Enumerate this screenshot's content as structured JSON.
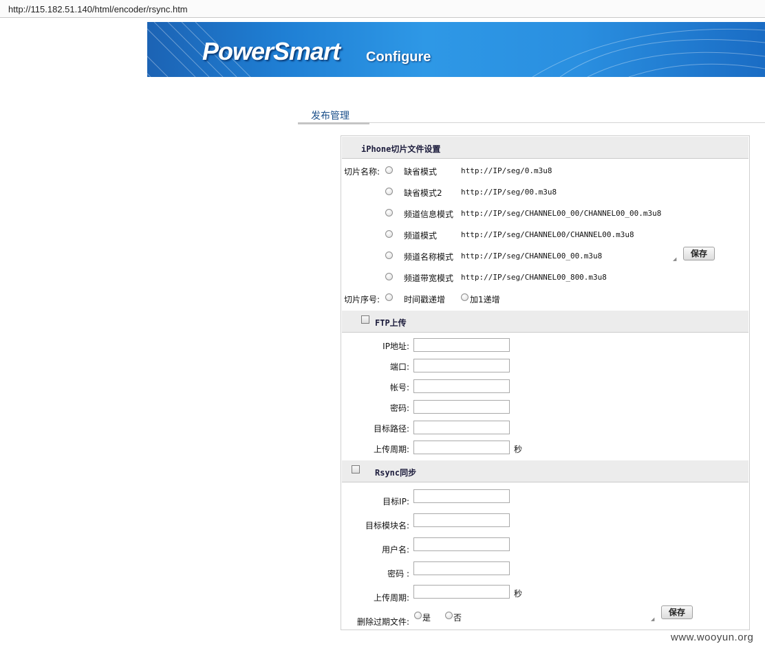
{
  "browser": {
    "url": "http://115.182.51.140/html/encoder/rsync.htm"
  },
  "banner": {
    "brand": "PowerSmart",
    "subtitle": "Configure"
  },
  "nav": {
    "tab_label": "发布管理"
  },
  "iphone_section": {
    "title": "iPhone切片文件设置",
    "name_label": "切片名称:",
    "modes": [
      {
        "name": "缺省模式",
        "url": "http://IP/seg/0.m3u8"
      },
      {
        "name": "缺省模式2",
        "url": "http://IP/seg/00.m3u8"
      },
      {
        "name": "频道信息模式",
        "url": "http://IP/seg/CHANNEL00_00/CHANNEL00_00.m3u8"
      },
      {
        "name": "频道模式",
        "url": "http://IP/seg/CHANNEL00/CHANNEL00.m3u8"
      },
      {
        "name": "频道名称模式",
        "url": "http://IP/seg/CHANNEL00_00.m3u8"
      },
      {
        "name": "频道带宽模式",
        "url": "http://IP/seg/CHANNEL00_800.m3u8"
      }
    ],
    "seq_label": "切片序号:",
    "seq_opt1": "时间戳递增",
    "seq_opt2": "加1递增",
    "save_label": "保存"
  },
  "ftp_section": {
    "title": "FTP上传",
    "ip_label": "IP地址:",
    "port_label": "端口:",
    "account_label": "帐号:",
    "password_label": "密码:",
    "path_label": "目标路径:",
    "period_label": "上传周期:",
    "period_unit": "秒"
  },
  "rsync_section": {
    "title": "Rsync同步",
    "target_ip_label": "目标IP:",
    "module_label": "目标模块名:",
    "user_label": "用户名:",
    "password_label": "密码 :",
    "period_label": "上传周期:",
    "period_unit": "秒",
    "delete_label": "删除过期文件:",
    "yes_label": "是",
    "no_label": "否",
    "save_label": "保存"
  },
  "watermark": {
    "text": "www.wooyun.org"
  }
}
